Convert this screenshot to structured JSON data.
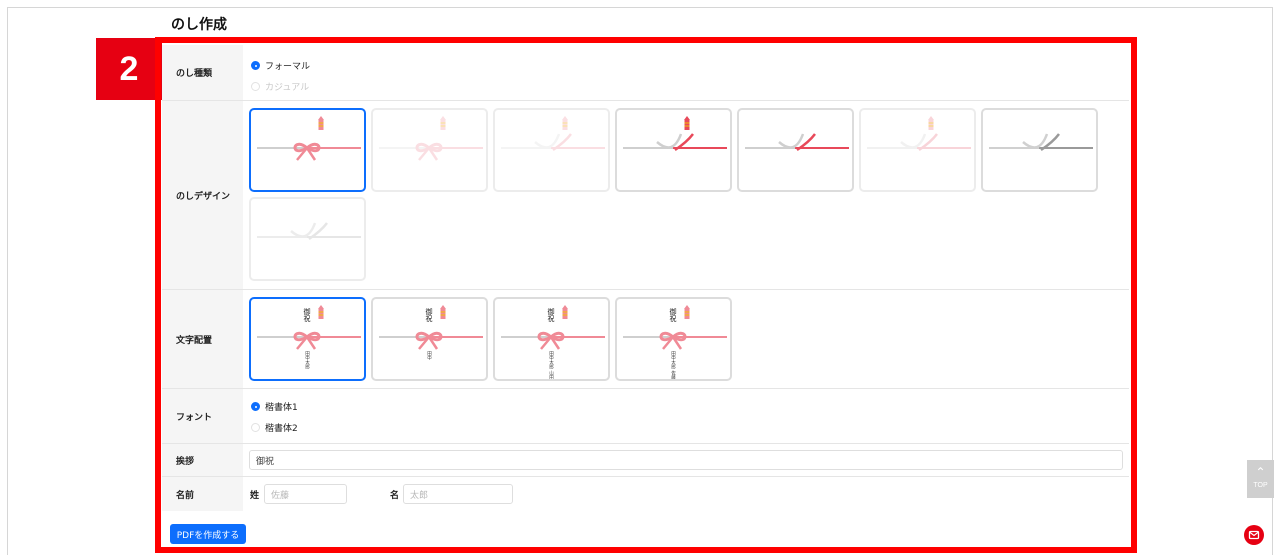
{
  "page": {
    "title": "のし作成"
  },
  "step_badge": "2",
  "form": {
    "noshi_type": {
      "label": "のし種類",
      "options": [
        {
          "label": "フォーマル",
          "checked": true
        },
        {
          "label": "カジュアル",
          "checked": false
        }
      ]
    },
    "noshi_design": {
      "label": "のしデザイン",
      "selected_index": 0,
      "tile_count": 8
    },
    "text_layout": {
      "label": "文字配置",
      "selected_index": 0,
      "tile_count": 4,
      "sample_top_text": "御祝",
      "sample_names": [
        "田中太郎",
        "田中",
        "田中太郎 山田一郎",
        "田中太郎 佐藤"
      ]
    },
    "font": {
      "label": "フォント",
      "options": [
        {
          "label": "楷書体1",
          "checked": true
        },
        {
          "label": "楷書体2",
          "checked": false
        }
      ]
    },
    "greeting": {
      "label": "挨拶",
      "value": "御祝"
    },
    "name": {
      "label": "名前",
      "last_label": "姓",
      "last_placeholder": "佐藤",
      "first_label": "名",
      "first_placeholder": "太郎"
    }
  },
  "buttons": {
    "pdf": "PDFを作成する",
    "top": "TOP"
  },
  "colors": {
    "accent": "#0d6efd",
    "brand_red": "#e60012",
    "highlight": "#ff0000",
    "ribbon": "#e8495a"
  },
  "icons": {
    "top_button": "chevron-up-icon",
    "mail_button": "mail-icon"
  }
}
